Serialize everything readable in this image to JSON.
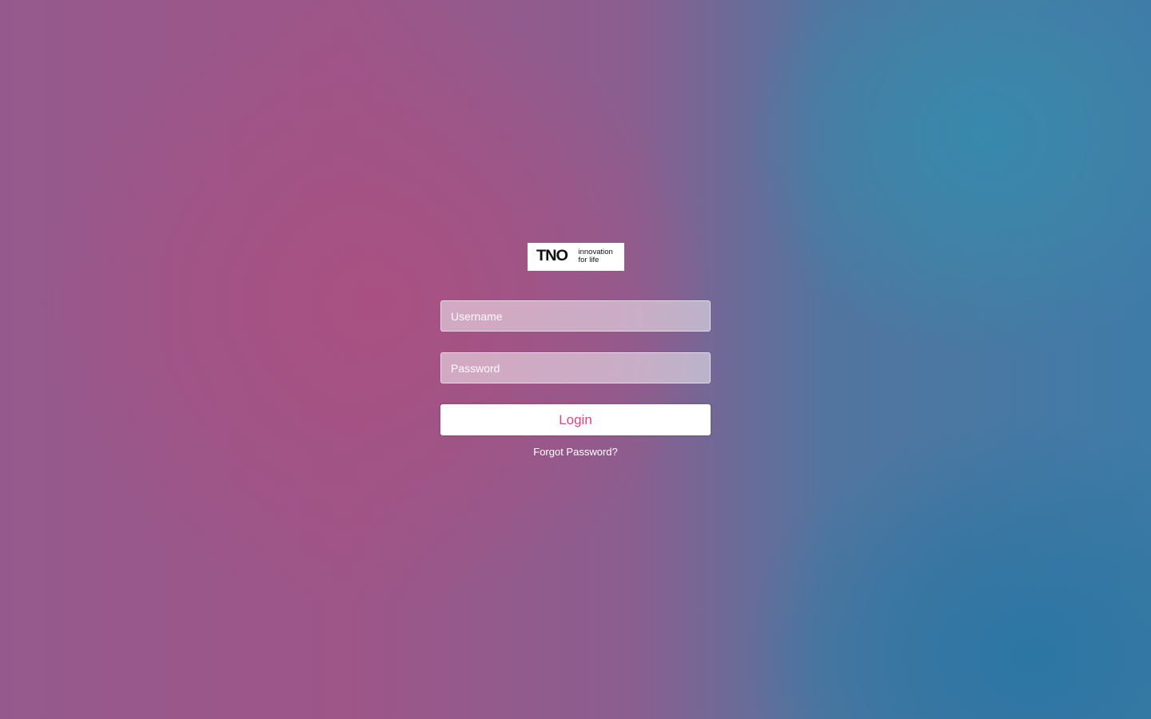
{
  "logo": {
    "brand": "TNO",
    "tagline_line1": "innovation",
    "tagline_line2": "for life"
  },
  "form": {
    "username_placeholder": "Username",
    "password_placeholder": "Password",
    "login_label": "Login",
    "forgot_label": "Forgot Password?"
  },
  "colors": {
    "accent": "#e0447f",
    "background_pink": "#a5527f",
    "background_blue": "#2f78a8"
  }
}
